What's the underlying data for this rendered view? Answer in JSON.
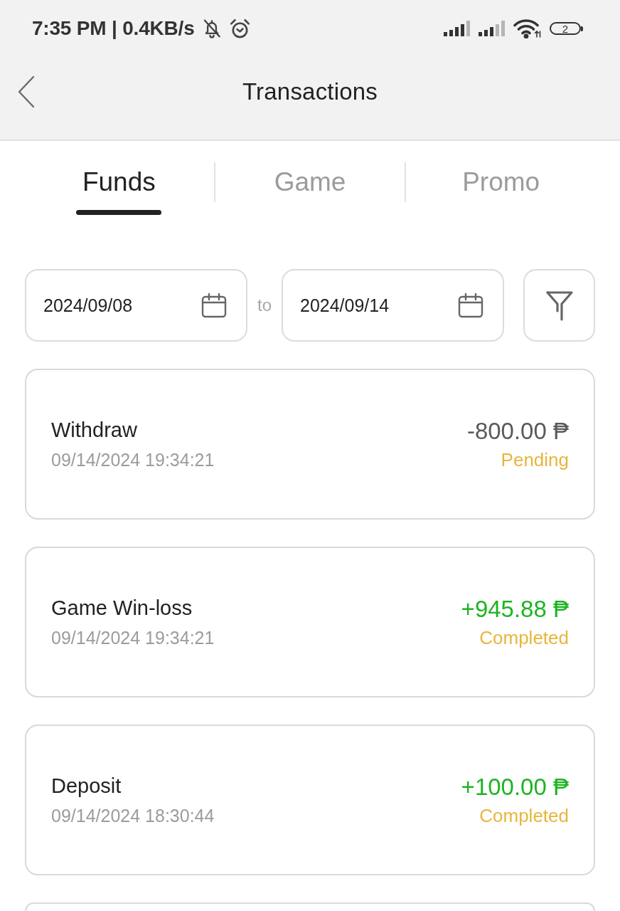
{
  "status_bar": {
    "text": "7:35 PM | 0.4KB/s",
    "battery": "2"
  },
  "header": {
    "title": "Transactions"
  },
  "tabs": [
    {
      "label": "Funds",
      "selected": true
    },
    {
      "label": "Game",
      "selected": false
    },
    {
      "label": "Promo",
      "selected": false
    }
  ],
  "date_filter": {
    "start_date": "2024/09/08",
    "separator": "to",
    "end_date": "2024/09/14"
  },
  "transactions": [
    {
      "title": "Withdraw",
      "time": "09/14/2024 19:34:21",
      "amount": "-800.00 ₱",
      "kind": "debit",
      "status": "Pending"
    },
    {
      "title": "Game Win-loss",
      "time": "09/14/2024 19:34:21",
      "amount": "+945.88 ₱",
      "kind": "credit",
      "status": "Completed"
    },
    {
      "title": "Deposit",
      "time": "09/14/2024 18:30:44",
      "amount": "+100.00 ₱",
      "kind": "credit",
      "status": "Completed"
    }
  ]
}
